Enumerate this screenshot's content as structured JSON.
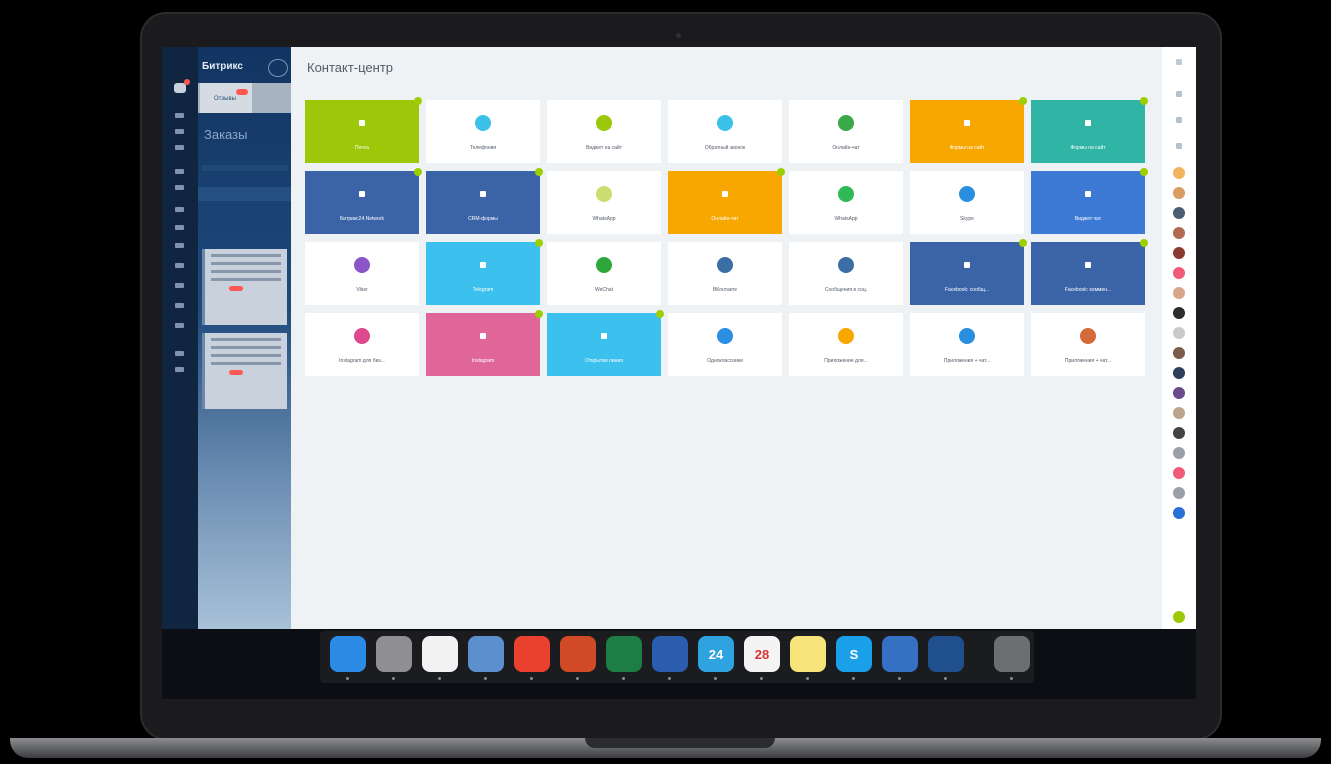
{
  "app": {
    "title": "Контакт-центр",
    "brand": "Битрикс",
    "tab_label": "Отзывы",
    "section_title": "Заказы"
  },
  "tiles": [
    {
      "name": "tile-email",
      "label": "Почта",
      "bg": "#9dc80a",
      "icon_color": "#ffffff",
      "colored": true,
      "check": true
    },
    {
      "name": "tile-telephony",
      "label": "Телефония",
      "bg": "#ffffff",
      "icon_color": "#3bc1e8",
      "colored": false,
      "check": false
    },
    {
      "name": "tile-chat-widget",
      "label": "Виджет на сайт",
      "bg": "#ffffff",
      "icon_color": "#9dc80a",
      "colored": false,
      "check": false
    },
    {
      "name": "tile-callback",
      "label": "Обратный звонок",
      "bg": "#ffffff",
      "icon_color": "#3bc1e8",
      "colored": false,
      "check": false
    },
    {
      "name": "tile-telegram-bot",
      "label": "Онлайн-чат",
      "bg": "#ffffff",
      "icon_color": "#3aa948",
      "colored": false,
      "check": false
    },
    {
      "name": "tile-forms",
      "label": "Формы на сайт",
      "bg": "#f7a700",
      "icon_color": "#ffffff",
      "colored": true,
      "check": true
    },
    {
      "name": "tile-open-lines",
      "label": "Формы на сайт",
      "bg": "#2fb4a6",
      "icon_color": "#ffffff",
      "colored": true,
      "check": true
    },
    {
      "name": "tile-bitrix24-network",
      "label": "Битрикс24.Network",
      "bg": "#3b64a8",
      "icon_color": "#ffffff",
      "colored": true,
      "check": true
    },
    {
      "name": "tile-ads-form",
      "label": "CRM-формы",
      "bg": "#3b64a8",
      "icon_color": "#ffffff",
      "colored": true,
      "check": true
    },
    {
      "name": "tile-whatsapp-web",
      "label": "WhatsApp",
      "bg": "#ffffff",
      "icon_color": "#c9de6e",
      "colored": false,
      "check": false
    },
    {
      "name": "tile-online-chat",
      "label": "Онлайн-чат",
      "bg": "#f7a700",
      "icon_color": "#ffffff",
      "colored": true,
      "check": true
    },
    {
      "name": "tile-whatsapp",
      "label": "WhatsApp",
      "bg": "#ffffff",
      "icon_color": "#2fba57",
      "colored": false,
      "check": false
    },
    {
      "name": "tile-skype",
      "label": "Skype",
      "bg": "#ffffff",
      "icon_color": "#2a8fe0",
      "colored": false,
      "check": false
    },
    {
      "name": "tile-bitrix-app",
      "label": "Виджет чат",
      "bg": "#3c7ad6",
      "icon_color": "#ffffff",
      "colored": true,
      "check": true
    },
    {
      "name": "tile-viber",
      "label": "Viber",
      "bg": "#ffffff",
      "icon_color": "#8b55c9",
      "colored": false,
      "check": false
    },
    {
      "name": "tile-telegram",
      "label": "Telegram",
      "bg": "#3cc0ed",
      "icon_color": "#ffffff",
      "colored": true,
      "check": true
    },
    {
      "name": "tile-wechat",
      "label": "WeChat",
      "bg": "#ffffff",
      "icon_color": "#2ea63a",
      "colored": false,
      "check": false
    },
    {
      "name": "tile-vkontakte",
      "label": "ВКонтакте",
      "bg": "#ffffff",
      "icon_color": "#3b6ea5",
      "colored": false,
      "check": false
    },
    {
      "name": "tile-vk-groups",
      "label": "Сообщения в соц.",
      "bg": "#ffffff",
      "icon_color": "#3b6ea5",
      "colored": false,
      "check": false
    },
    {
      "name": "tile-facebook",
      "label": "Facebook: сообщ...",
      "bg": "#3b64a8",
      "icon_color": "#ffffff",
      "colored": true,
      "check": true
    },
    {
      "name": "tile-facebook-comments",
      "label": "Facebook: коммен...",
      "bg": "#3b64a8",
      "icon_color": "#ffffff",
      "colored": true,
      "check": true
    },
    {
      "name": "tile-instagram",
      "label": "Instagram для биз...",
      "bg": "#ffffff",
      "icon_color": "#e0488e",
      "colored": false,
      "check": false
    },
    {
      "name": "tile-instagram-direct",
      "label": "Instagram",
      "bg": "#e0669a",
      "icon_color": "#ffffff",
      "colored": true,
      "check": true
    },
    {
      "name": "tile-network-chat",
      "label": "Открытая линия",
      "bg": "#3cc0ed",
      "icon_color": "#ffffff",
      "colored": true,
      "check": true
    },
    {
      "name": "tile-ok",
      "label": "Одноклассники",
      "bg": "#ffffff",
      "icon_color": "#2a8fe0",
      "colored": false,
      "check": false
    },
    {
      "name": "tile-yandex",
      "label": "Приложение для...",
      "bg": "#ffffff",
      "icon_color": "#f7a700",
      "colored": false,
      "check": false
    },
    {
      "name": "tile-apps",
      "label": "Приложения + чат...",
      "bg": "#ffffff",
      "icon_color": "#2a8fe0",
      "colored": false,
      "check": false
    },
    {
      "name": "tile-marketplace",
      "label": "Приложения + чат...",
      "bg": "#ffffff",
      "icon_color": "#d36b3a",
      "colored": false,
      "check": false
    }
  ],
  "rail_avatars": [
    "#f0b35e",
    "#d99c62",
    "#4b5d75",
    "#b06a4f",
    "#8a3b2f",
    "#f05b7a",
    "#d7a58a",
    "#2d2d2d",
    "#c9c9c9",
    "#7a5b4c",
    "#2f3f59",
    "#6d4b8a",
    "#bca48c",
    "#444444",
    "#9aa0a8",
    "#f05b7a",
    "#9aa0a8",
    "#2a6fd6"
  ],
  "dock": [
    {
      "name": "finder-icon",
      "color": "#2b8ae6"
    },
    {
      "name": "system-preferences-icon",
      "color": "#8e8e93"
    },
    {
      "name": "textedit-icon",
      "color": "#f2f2f2"
    },
    {
      "name": "preview-icon",
      "color": "#5b8fce"
    },
    {
      "name": "chrome-icon",
      "color": "#e9412e"
    },
    {
      "name": "powerpoint-icon",
      "color": "#d04a25"
    },
    {
      "name": "excel-icon",
      "color": "#1e7d44"
    },
    {
      "name": "word-icon",
      "color": "#2b5daf"
    },
    {
      "name": "bitrix24-icon",
      "color": "#2fa3e0",
      "text": "24"
    },
    {
      "name": "calendar-icon",
      "color": "#f4f4f4",
      "text": "28"
    },
    {
      "name": "notes-icon",
      "color": "#f7e47b"
    },
    {
      "name": "skype-icon",
      "color": "#1aa0e8",
      "text": "S"
    },
    {
      "name": "lightning-icon",
      "color": "#3570c2"
    },
    {
      "name": "quicktime-icon",
      "color": "#1f4f8c"
    },
    {
      "name": "trash-icon",
      "color": "#6d6e72"
    }
  ],
  "colors": {
    "accent": "#9dc80a",
    "nav": "#0f2540",
    "panel": "#eef2f5"
  }
}
